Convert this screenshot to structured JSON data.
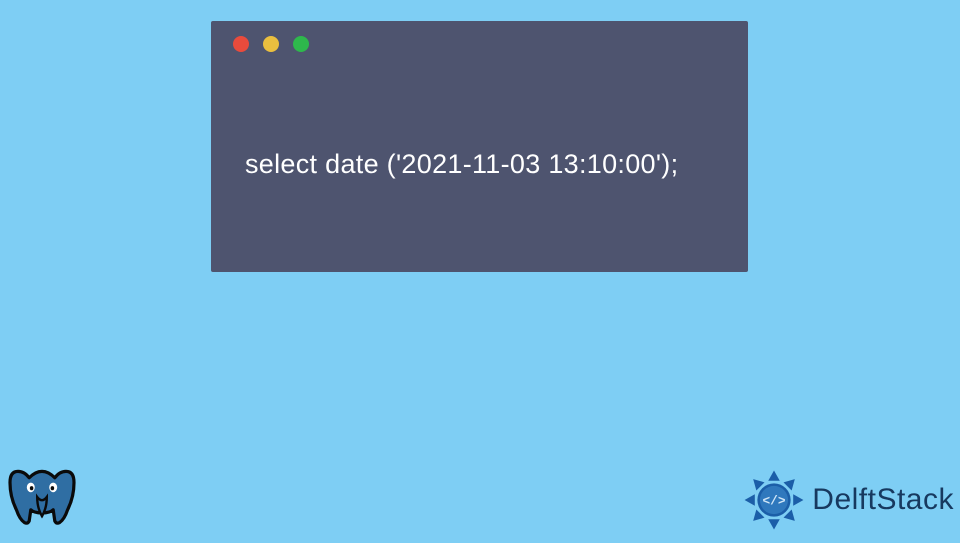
{
  "code_window": {
    "traffic_lights": [
      "red",
      "yellow",
      "green"
    ],
    "code": "select date ('2021-11-03 13:10:00');"
  },
  "brand": {
    "name": "DelftStack"
  },
  "icons": {
    "bottom_left": "postgresql-elephant-icon",
    "brand_mark": "delftstack-logo-icon"
  }
}
